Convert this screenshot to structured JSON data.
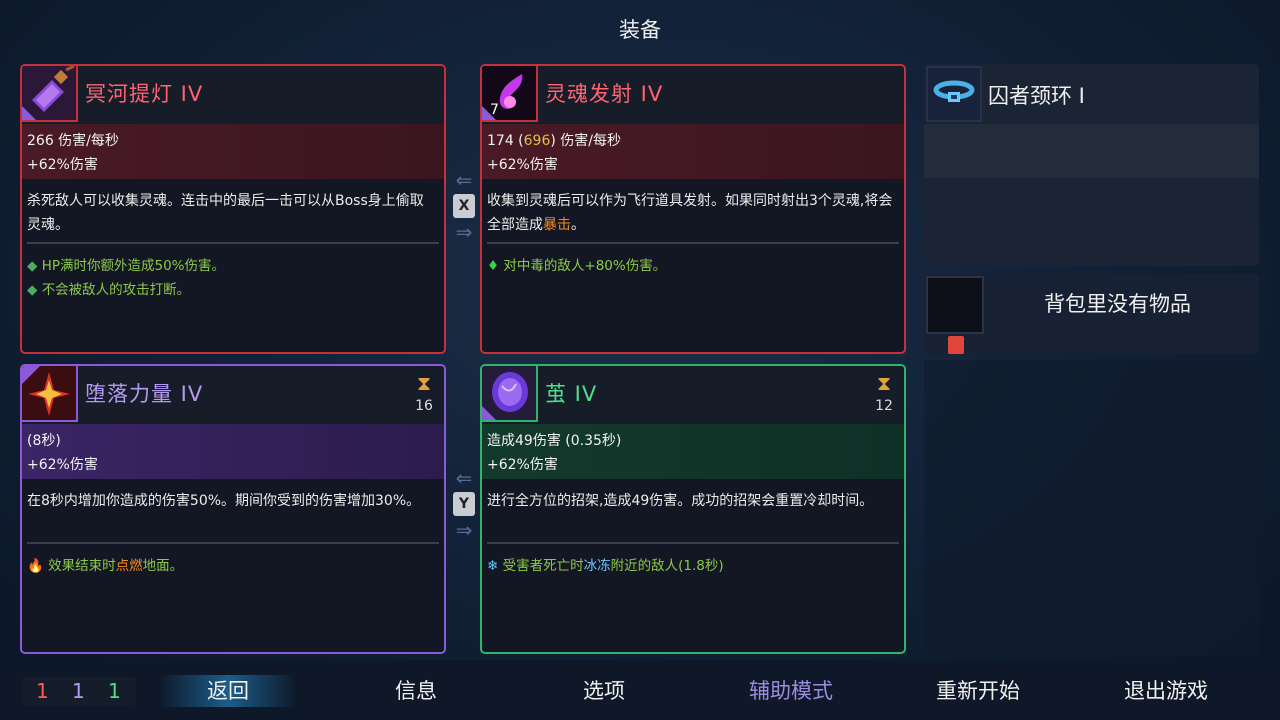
{
  "title": "装备",
  "cards": {
    "top_left": {
      "name": "冥河提灯 IV",
      "stat1": "266 伤害/每秒",
      "stat2": "+62%伤害",
      "desc": "杀死敌人可以收集灵魂。连击中的最后一击可以从Boss身上偷取灵魂。",
      "bullet1": "HP满时你额外造成50%伤害。",
      "bullet2": "不会被敌人的攻击打断。",
      "icon": "lantern-icon",
      "color": "#c6303a"
    },
    "top_right": {
      "name": "灵魂发射 IV",
      "icon_badge": "7",
      "stat1_a": "174 (",
      "stat1_b": "696",
      "stat1_c": ") 伤害/每秒",
      "stat2": "+62%伤害",
      "desc_a": "收集到灵魂后可以作为飞行道具发射。如果同时射出3个灵魂,将会全部造成",
      "desc_b": "暴击",
      "desc_c": "。",
      "bullet1": "对中毒的敌人+80%伤害。",
      "icon": "soul-flame-icon",
      "color": "#c6303a"
    },
    "bottom_left": {
      "name": "堕落力量 IV",
      "cooldown": "16",
      "stat1": "(8秒)",
      "stat2": "+62%伤害",
      "desc": "在8秒内增加你造成的伤害50%。期间你受到的伤害增加30%。",
      "bullet1_a": "效果结束时",
      "bullet1_b": "点燃",
      "bullet1_c": "地面。",
      "icon": "fallen-power-icon",
      "color": "#8a5ad8"
    },
    "bottom_right": {
      "name": "茧 IV",
      "cooldown": "12",
      "stat1": "造成49伤害 (0.35秒)",
      "stat2": "+62%伤害",
      "desc": "进行全方位的招架,造成49伤害。成功的招架会重置冷却时间。",
      "bullet1_a": "受害者死亡时",
      "bullet1_b": "冰冻",
      "bullet1_c": "附近的敌人(1.8秒)",
      "icon": "cocoon-icon",
      "color": "#2fb56a"
    }
  },
  "swap_keys": {
    "top": "X",
    "bottom": "Y"
  },
  "amulet": {
    "name": "囚者颈环 I",
    "icon": "collar-icon"
  },
  "backpack": {
    "text": "背包里没有物品",
    "icon": "backpack-icon"
  },
  "counters": {
    "red": "1",
    "purple": "1",
    "green": "1"
  },
  "menu": {
    "back": "返回",
    "info": "信息",
    "options": "选项",
    "assist": "辅助模式",
    "restart": "重新开始",
    "quit": "退出游戏"
  },
  "colors": {
    "red": "#c6303a",
    "purple": "#8a5ad8",
    "green": "#2fb56a",
    "bullet_green": "#8cc84a",
    "yellow": "#e2c040",
    "orange": "#f08a24",
    "ice": "#6ac8ff",
    "assist": "#9c8ce0"
  }
}
